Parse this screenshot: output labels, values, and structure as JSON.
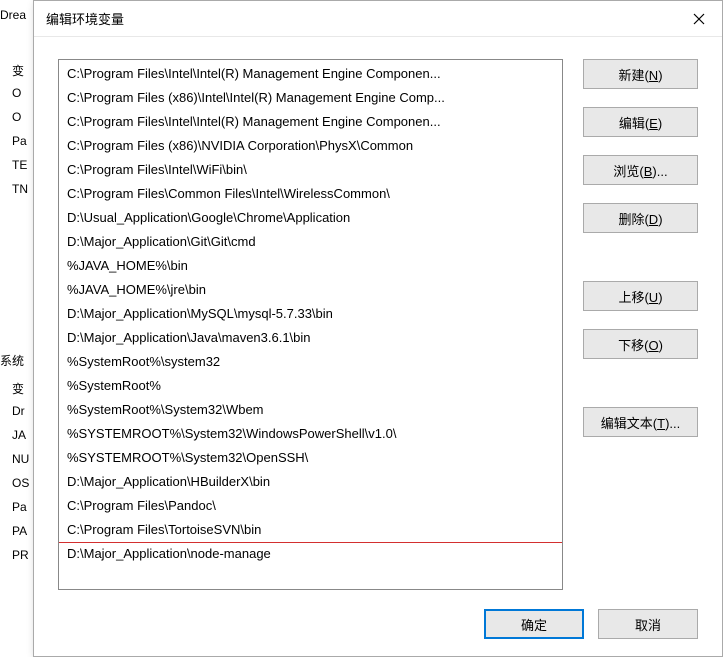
{
  "background": {
    "left_text": "Drea",
    "sys_heading": "系统",
    "labels1": [
      "变",
      "O",
      "O",
      "Pa",
      "TE",
      "TN"
    ],
    "labels2": [
      "变",
      "Dr",
      "JA",
      "NU",
      "OS",
      "Pa",
      "PA",
      "PR"
    ]
  },
  "dialog": {
    "title": "编辑环境变量"
  },
  "list": {
    "items": [
      "C:\\Program Files\\Intel\\Intel(R) Management Engine Componen...",
      "C:\\Program Files (x86)\\Intel\\Intel(R) Management Engine Comp...",
      "C:\\Program Files\\Intel\\Intel(R) Management Engine Componen...",
      "C:\\Program Files (x86)\\NVIDIA Corporation\\PhysX\\Common",
      "C:\\Program Files\\Intel\\WiFi\\bin\\",
      "C:\\Program Files\\Common Files\\Intel\\WirelessCommon\\",
      "D:\\Usual_Application\\Google\\Chrome\\Application",
      "D:\\Major_Application\\Git\\Git\\cmd",
      "%JAVA_HOME%\\bin",
      "%JAVA_HOME%\\jre\\bin",
      "D:\\Major_Application\\MySQL\\mysql-5.7.33\\bin",
      "D:\\Major_Application\\Java\\maven3.6.1\\bin",
      "%SystemRoot%\\system32",
      "%SystemRoot%",
      "%SystemRoot%\\System32\\Wbem",
      "%SYSTEMROOT%\\System32\\WindowsPowerShell\\v1.0\\",
      "%SYSTEMROOT%\\System32\\OpenSSH\\",
      "D:\\Major_Application\\HBuilderX\\bin",
      "C:\\Program Files\\Pandoc\\",
      "C:\\Program Files\\TortoiseSVN\\bin",
      "D:\\Major_Application\\node-manage"
    ],
    "highlighted_index": 20
  },
  "buttons": {
    "new": "新建(N)",
    "edit": "编辑(E)",
    "browse": "浏览(B)...",
    "delete": "删除(D)",
    "move_up": "上移(U)",
    "move_down": "下移(O)",
    "edit_text": "编辑文本(T)..."
  },
  "footer": {
    "ok": "确定",
    "cancel": "取消"
  }
}
